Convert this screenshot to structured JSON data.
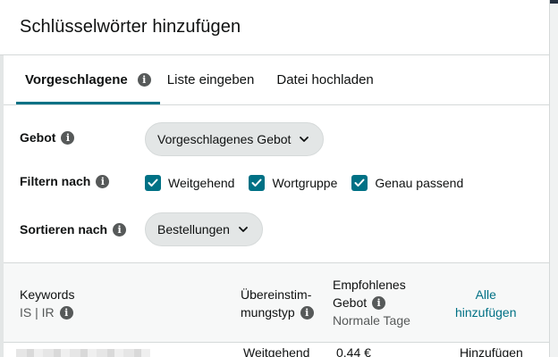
{
  "modal": {
    "title": "Schlüsselwörter hinzufügen"
  },
  "tabs": [
    {
      "label": "Vorgeschlagene",
      "active": true
    },
    {
      "label": "Liste eingeben",
      "active": false
    },
    {
      "label": "Datei hochladen",
      "active": false
    }
  ],
  "form": {
    "bid": {
      "label": "Gebot",
      "selected": "Vorgeschlagenes Gebot"
    },
    "filter": {
      "label": "Filtern nach",
      "options": [
        {
          "label": "Weitgehend",
          "checked": true
        },
        {
          "label": "Wortgruppe",
          "checked": true
        },
        {
          "label": "Genau passend",
          "checked": true
        }
      ]
    },
    "sort": {
      "label": "Sortieren nach",
      "selected": "Bestellungen"
    }
  },
  "table": {
    "headers": {
      "keywords": "Keywords",
      "keywords_sub": "IS | IR",
      "match_type_1": "Übereinstim-",
      "match_type_2": "mungstyp",
      "suggested_bid_1": "Empfohlenes",
      "suggested_bid_2": "Gebot",
      "suggested_bid_sub": "Normale Tage",
      "add_all_1": "Alle",
      "add_all_2": "hinzufügen"
    },
    "rows": [
      {
        "match_type": "Weitgehend",
        "bid": "0,44 €",
        "action": "Hinzufügen"
      }
    ]
  },
  "colors": {
    "accent": "#007185",
    "pill": "#e3e6e6",
    "text": "#0f1111",
    "muted": "#565959"
  },
  "icons": {
    "info": "info-icon",
    "dropdown": "chevron-down-icon",
    "checkbox": "checkmark-icon"
  }
}
